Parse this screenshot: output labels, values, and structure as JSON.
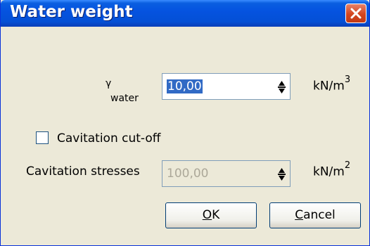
{
  "dialog": {
    "title": "Water weight",
    "gamma_symbol": "γ",
    "gamma_subscript": "water",
    "water_value": "10,00",
    "water_unit_base": "kN/m",
    "water_unit_exp": "3",
    "cutoff_label": "Cavitation cut-off",
    "cutoff_checked": false,
    "stress_label": "Cavitation stresses",
    "stress_value": "100,00",
    "stress_unit_base": "kN/m",
    "stress_unit_exp": "2",
    "ok_label_first": "O",
    "ok_label_rest": "K",
    "cancel_label_first": "C",
    "cancel_label_rest": "ancel"
  },
  "icons": {
    "close": "close-icon",
    "spinner_arrows": "spinner-arrows-icon"
  },
  "colors": {
    "titlebar": "#0553e0",
    "close": "#d3451f",
    "dialog_bg": "#ece9d8",
    "selection": "#316ac5"
  }
}
